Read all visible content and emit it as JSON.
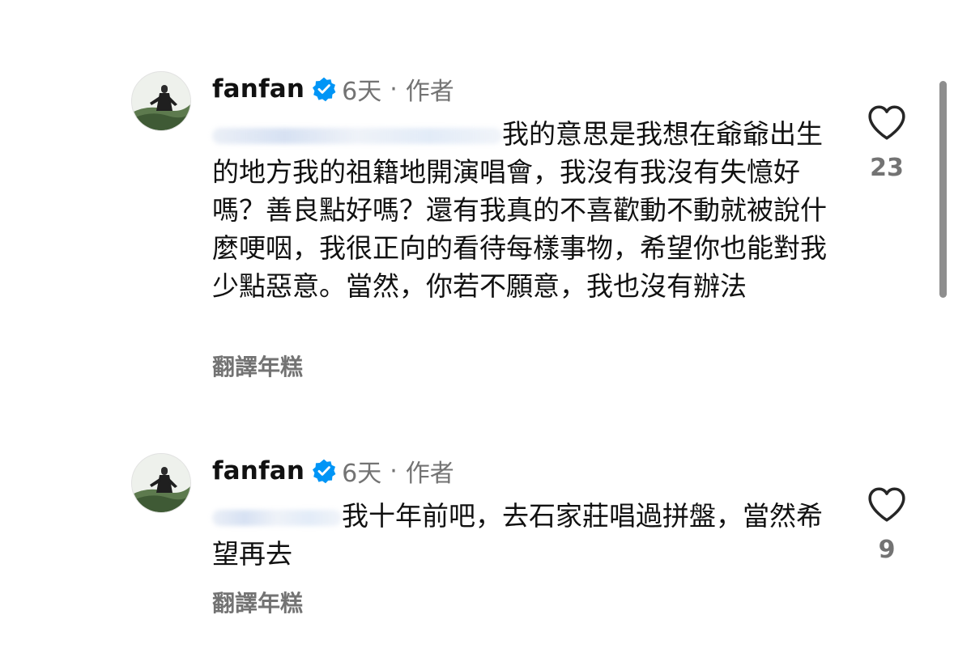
{
  "comments": [
    {
      "username": "fanfan",
      "time": "6天",
      "separator": "·",
      "author_label": "作者",
      "mention": "",
      "text": "我的意思是我想在爺爺出生的地方我的祖籍地開演唱會，我沒有我沒有失憶好嗎？善良點好嗎？還有我真的不喜歡動不動就被說什麼哽咽，我很正向的看待每樣事物，希望你也能對我少點惡意。當然，你若不願意，我也沒有辦法",
      "translate_label": "翻譯年糕",
      "likes": "23"
    },
    {
      "username": "fanfan",
      "time": "6天",
      "separator": "·",
      "author_label": "作者",
      "mention": "",
      "text": "我十年前吧，去石家莊唱過拼盤，當然希望再去",
      "translate_label": "翻譯年糕",
      "likes": "9"
    }
  ],
  "icons": {
    "verified": "verified-badge-icon",
    "like": "heart-outline-icon"
  },
  "colors": {
    "verified_blue": "#0095f6",
    "secondary_text": "#737373",
    "primary_text": "#111111"
  }
}
